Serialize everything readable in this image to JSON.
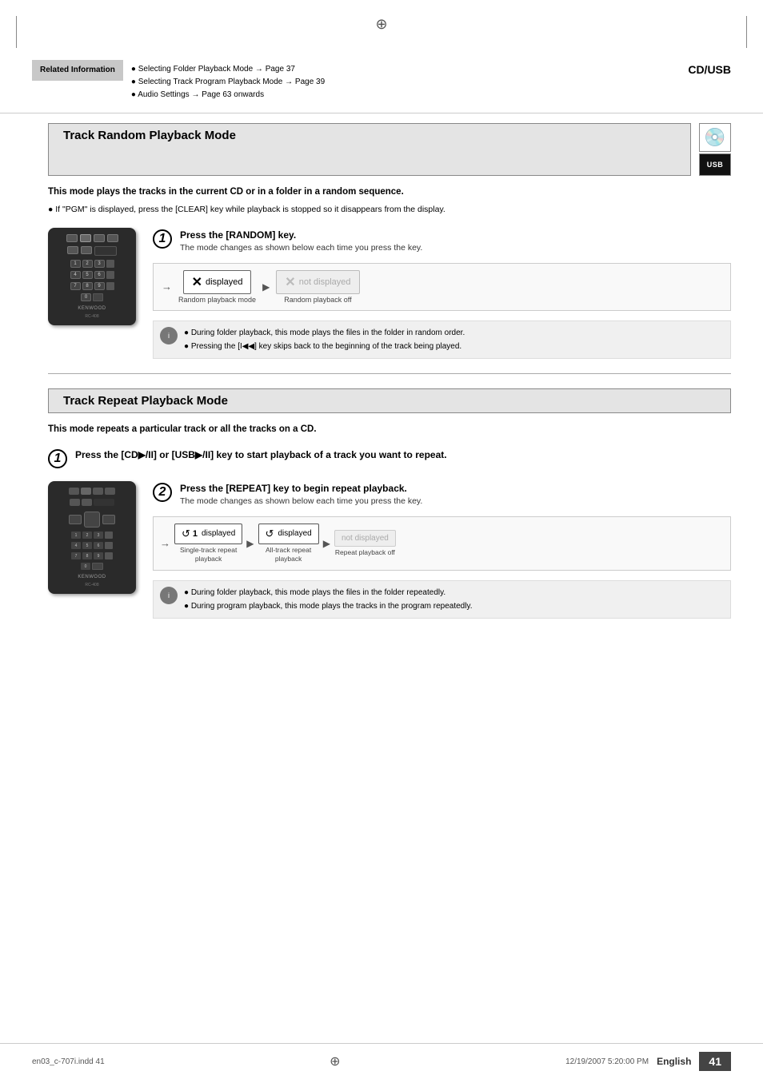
{
  "page": {
    "title": "CD/USB",
    "language": "English",
    "page_number": "41",
    "file_info": "en03_c-707i.indd   41",
    "date_time": "12/19/2007  5:20:00 PM"
  },
  "header": {
    "crosshair": "⊕",
    "related_info": {
      "title": "Related Information",
      "items": [
        "Selecting Folder Playback Mode → Page 37",
        "Selecting Track Program Playback Mode → Page 39",
        "Audio Settings → Page 63 onwards"
      ]
    }
  },
  "track_random": {
    "section_title": "Track Random Playback Mode",
    "description": "This mode plays the tracks in the current CD or in a folder in a random sequence.",
    "pgm_note": "If \"PGM\" is displayed, press the [CLEAR] key while playback is stopped so it disappears from the display.",
    "step1": {
      "number": "1",
      "text": "Press the [RANDOM] key.",
      "sub_text": "The mode changes as shown below each time you press the key."
    },
    "mode_diagram": {
      "arrow_start": "→",
      "state1": {
        "icon": "✕",
        "label_right": "displayed",
        "caption": "Random playback mode"
      },
      "arrow_mid": "▶",
      "state2": {
        "icon": "✕",
        "label_right": "not displayed",
        "caption": "Random playback off"
      }
    },
    "notes": [
      "During folder playback, this mode plays the files in the folder in random order.",
      "Pressing the [I◀◀] key skips back to the beginning of the track being played."
    ]
  },
  "track_repeat": {
    "section_title": "Track Repeat Playback Mode",
    "description": "This mode repeats a particular track or all the tracks on a CD.",
    "step1": {
      "number": "1",
      "text": "Press the [CD▶/II] or [USB▶/II] key to start playback of a track you want to repeat."
    },
    "step2": {
      "number": "2",
      "text": "Press the [REPEAT] key to begin repeat playback.",
      "sub_text": "The mode changes as shown below each time you press the key."
    },
    "mode_diagram": {
      "arrow_start": "→",
      "state1": {
        "icon": "↺1",
        "label_right": "displayed",
        "caption": "Single-track repeat playback"
      },
      "arrow_mid1": "▶",
      "state2": {
        "icon": "↺",
        "label_right": "displayed",
        "caption": "All-track repeat playback"
      },
      "arrow_mid2": "▶",
      "state3": {
        "label_right": "not displayed",
        "caption": "Repeat playback off"
      }
    },
    "notes": [
      "During folder playback, this mode plays the files in the folder repeatedly.",
      "During program playback, this mode plays the tracks in the program repeatedly."
    ]
  }
}
